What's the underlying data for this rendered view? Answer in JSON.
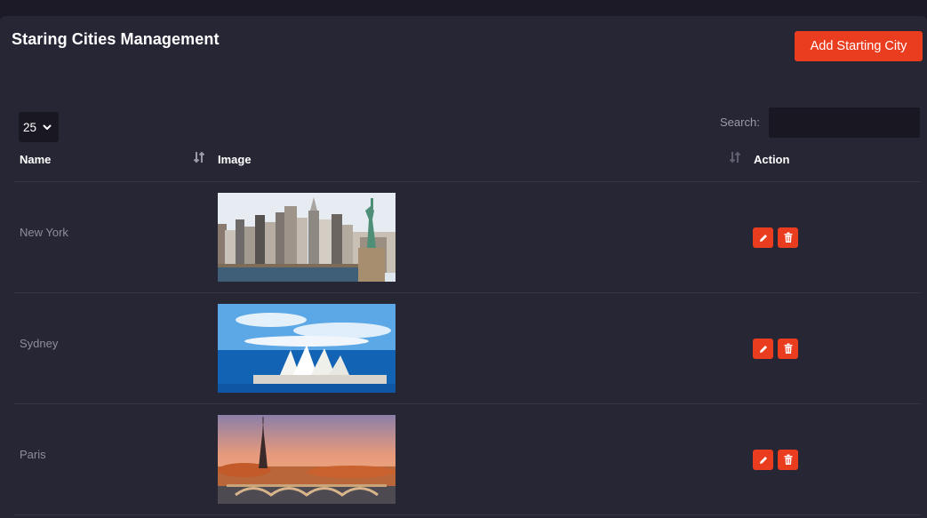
{
  "header": {
    "title": "Staring Cities Management",
    "add_button": "Add Starting City"
  },
  "controls": {
    "page_length": "25",
    "search_label": "Search:",
    "search_value": ""
  },
  "table": {
    "columns": [
      "Name",
      "Image",
      "Action"
    ],
    "rows": [
      {
        "name": "New York"
      },
      {
        "name": "Sydney"
      },
      {
        "name": "Paris"
      }
    ]
  },
  "colors": {
    "accent": "#ea3c1e",
    "background": "#262635",
    "page": "#1b1a26"
  },
  "icons": {
    "edit": "pencil-icon",
    "delete": "trash-icon",
    "sort": "sort-icon",
    "dropdown": "chevron-down-icon"
  }
}
